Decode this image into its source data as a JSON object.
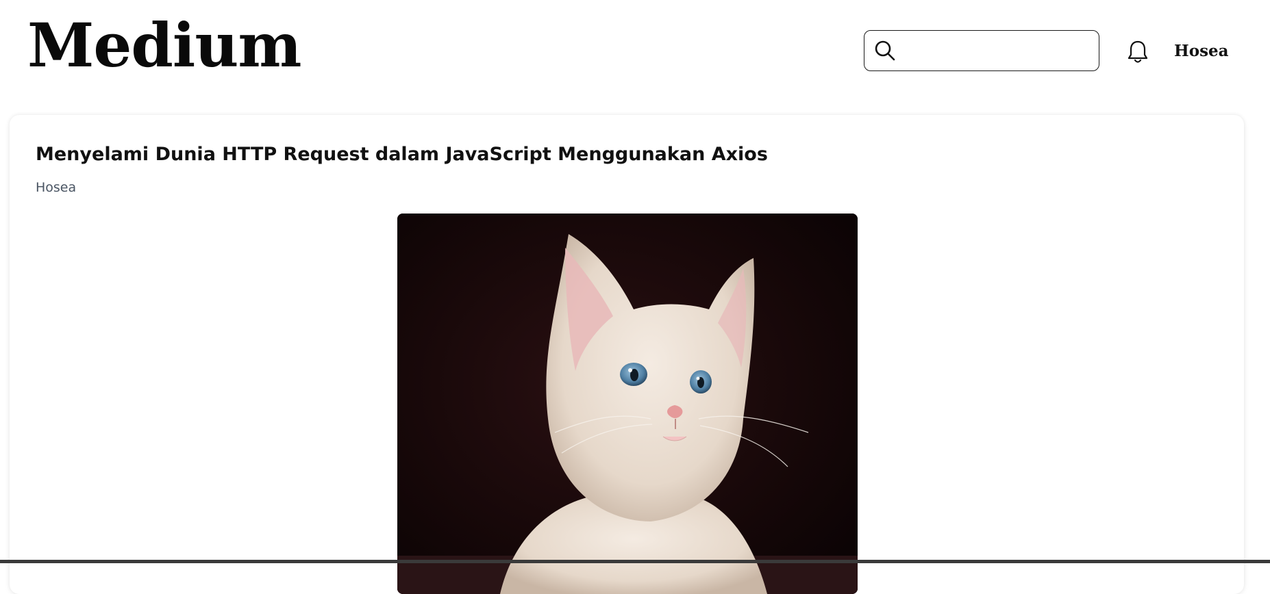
{
  "header": {
    "logo_text": "Medium",
    "search": {
      "placeholder": "",
      "value": "",
      "icon": "search-icon"
    },
    "notification_icon": "bell-icon",
    "user_name": "Hosea"
  },
  "article": {
    "title": "Menyelami Dunia HTTP Request dalam JavaScript Menggunakan Axios",
    "author": "Hosea",
    "image_alt": "kitten"
  },
  "colors": {
    "text": "#111111",
    "author_text": "#4a5563",
    "border": "#1a1a1a",
    "background": "#ffffff"
  }
}
